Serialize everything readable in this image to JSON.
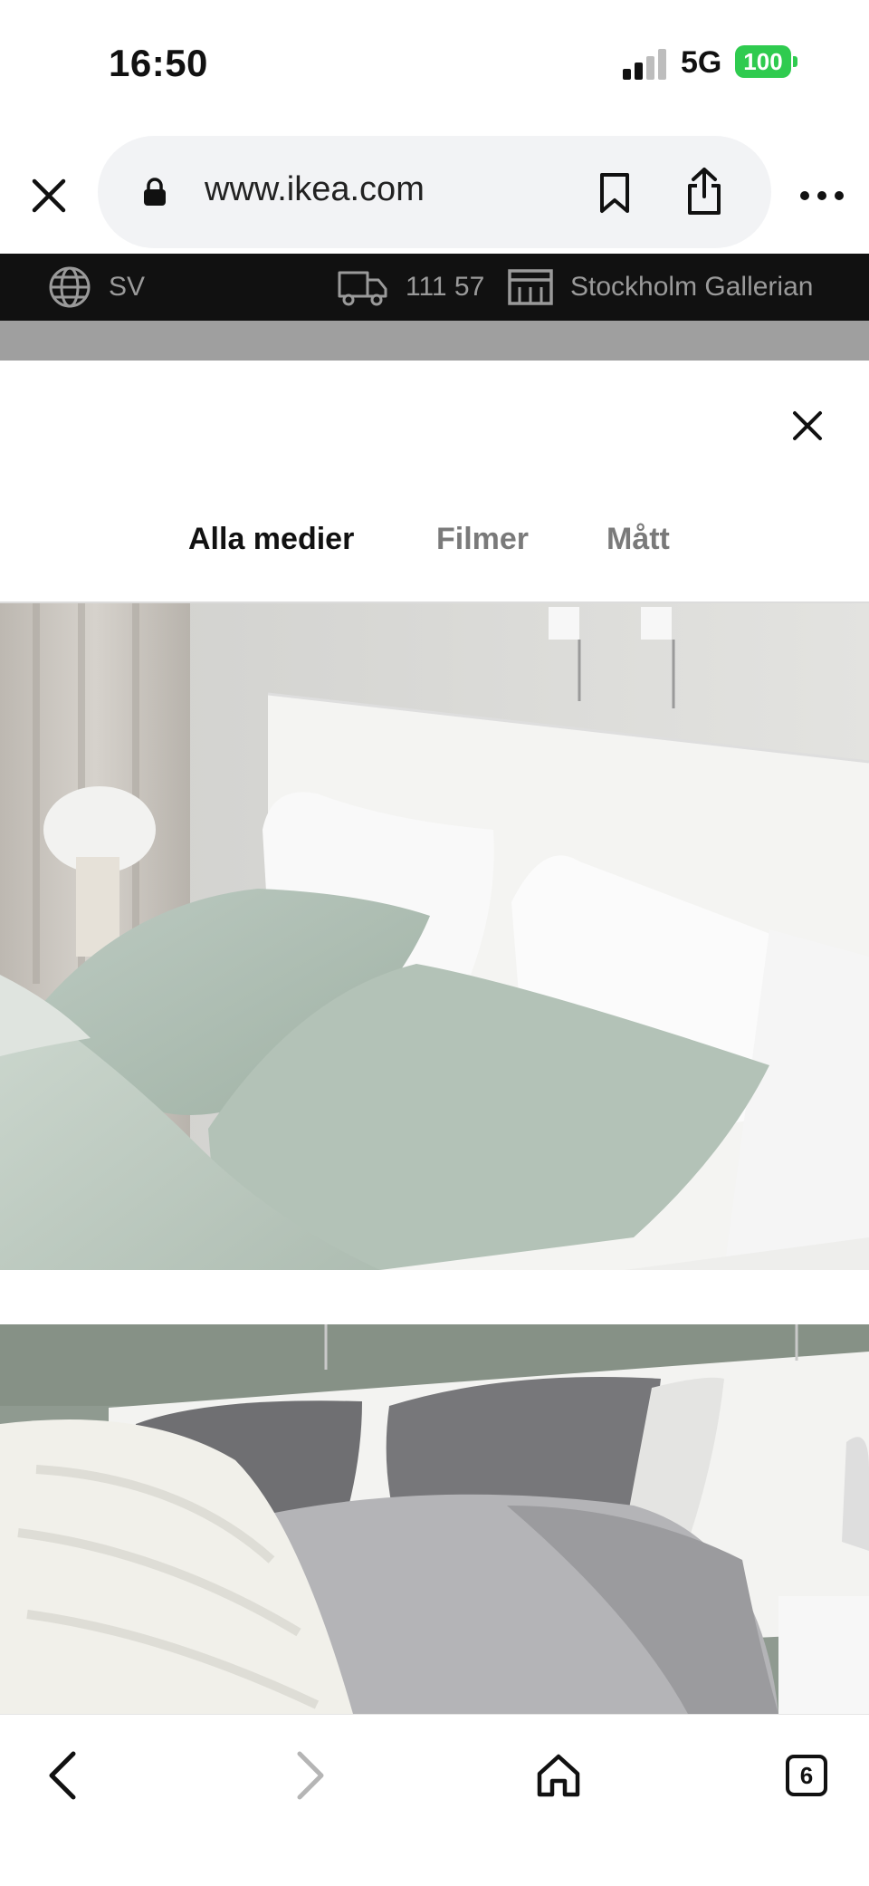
{
  "status_bar": {
    "time": "16:50",
    "network": "5G",
    "battery": "100",
    "battery_color": "#2fcb4f"
  },
  "browser": {
    "url": "www.ikea.com",
    "icons": [
      "close-icon",
      "lock-icon",
      "bookmark-icon",
      "share-icon",
      "more-icon"
    ]
  },
  "site_header": {
    "language": "SV",
    "postal_code": "111 57",
    "store": "Stockholm Gallerian"
  },
  "modal": {
    "tabs": [
      {
        "label": "Alla medier",
        "active": true
      },
      {
        "label": "Filmer",
        "active": false
      },
      {
        "label": "Mått",
        "active": false
      }
    ],
    "accent_color": "#0058a3",
    "media": [
      {
        "description": "bed-pillows-green-white"
      },
      {
        "description": "bed-grey-duvet-white-throw"
      }
    ]
  },
  "toolbar": {
    "tab_count": "6",
    "icons": [
      "back-icon",
      "forward-icon",
      "home-icon",
      "tabs-icon"
    ]
  }
}
